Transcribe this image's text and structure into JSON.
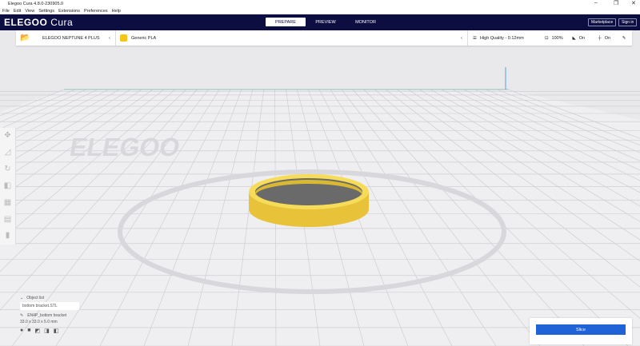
{
  "window": {
    "title": "Elegoo Cura 4.8.0-230905.0"
  },
  "menu": [
    "File",
    "Edit",
    "View",
    "Settings",
    "Extensions",
    "Preferences",
    "Help"
  ],
  "header": {
    "logo_main": "ELEGOO",
    "logo_sub": "Cura",
    "stages": [
      "PREPARE",
      "PREVIEW",
      "MONITOR"
    ],
    "active_stage": "PREPARE",
    "marketplace": "Marketplace",
    "signin": "Sign in"
  },
  "toolbar": {
    "printer": "ELEGOO NEPTUNE 4 PLUS",
    "material": "Generic PLA",
    "profile": "High Quality - 0.12mm",
    "infill": "100%",
    "support": "On",
    "adhesion": "On"
  },
  "build_plate": {
    "watermark": "ELEGOO"
  },
  "objects": {
    "header": "Object list",
    "file": "bottom bracket.STL",
    "job_name": "EN4P_bottom bracket",
    "dimensions": "33.0 x 33.0 x 5.0 mm"
  },
  "slice": {
    "label": "Slice"
  },
  "colors": {
    "header": "#0c0d41",
    "accent": "#2063d6",
    "model": "#f5d442"
  }
}
